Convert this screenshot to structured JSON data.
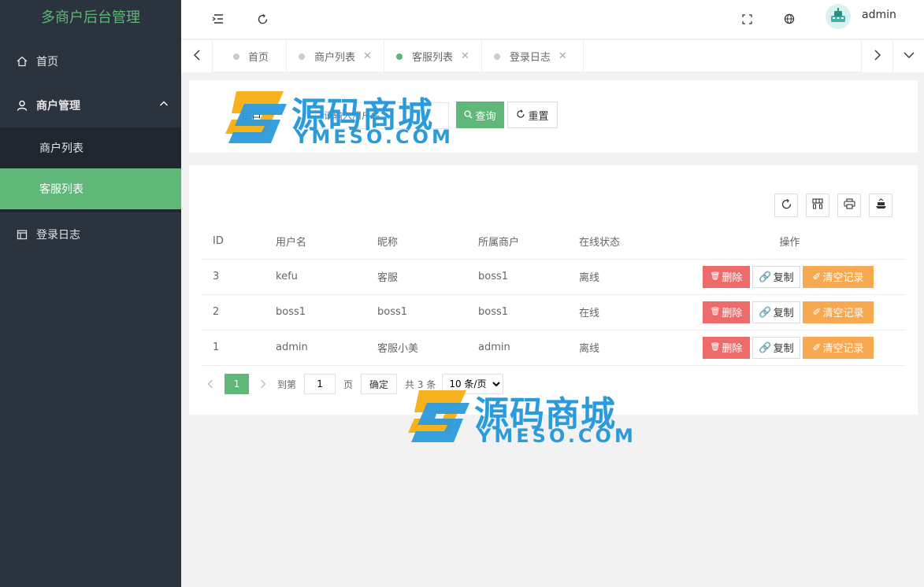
{
  "app": {
    "title": "多商户后台管理"
  },
  "colors": {
    "accent": "#5fb878",
    "sidebar_bg": "#2b333e",
    "danger": "#ee6b6b",
    "warning": "#f6a951",
    "watermark": "#2b9bdc"
  },
  "sidebar": {
    "home": {
      "label": "首页",
      "icon": "home-icon"
    },
    "group": {
      "label": "商户管理",
      "icon": "user-icon"
    },
    "sub_items": [
      {
        "label": "商户列表",
        "active": false
      },
      {
        "label": "客服列表",
        "active": true
      }
    ],
    "login_log": {
      "label": "登录日志",
      "icon": "calendar-icon"
    }
  },
  "header": {
    "user": "admin"
  },
  "tabs": [
    {
      "label": "首页",
      "closable": false,
      "active": false
    },
    {
      "label": "商户列表",
      "closable": true,
      "active": false
    },
    {
      "label": "客服列表",
      "closable": true,
      "active": true
    },
    {
      "label": "登录日志",
      "closable": true,
      "active": false
    }
  ],
  "search": {
    "label": "用户名",
    "placeholder": "请输入用户名",
    "query_label": "查询",
    "reset_label": "重置"
  },
  "table": {
    "headers": {
      "id": "ID",
      "username": "用户名",
      "nickname": "昵称",
      "merchant": "所属商户",
      "status": "在线状态",
      "ops": "操作"
    },
    "rows": [
      {
        "id": "3",
        "username": "kefu",
        "nickname": "客服",
        "merchant": "boss1",
        "status": "离线"
      },
      {
        "id": "2",
        "username": "boss1",
        "nickname": "boss1",
        "merchant": "boss1",
        "status": "在线"
      },
      {
        "id": "1",
        "username": "admin",
        "nickname": "客服小美",
        "merchant": "admin",
        "status": "离线"
      }
    ],
    "actions": {
      "delete": "删除",
      "copy": "复制",
      "clear": "清空记录"
    }
  },
  "pager": {
    "current": "1",
    "goto_prefix": "到第",
    "goto_value": "1",
    "goto_suffix": "页",
    "confirm": "确定",
    "total": "共 3 条",
    "page_size": "10 条/页"
  },
  "watermark": {
    "cn": "源码商城",
    "en": "YMESO.COM"
  }
}
